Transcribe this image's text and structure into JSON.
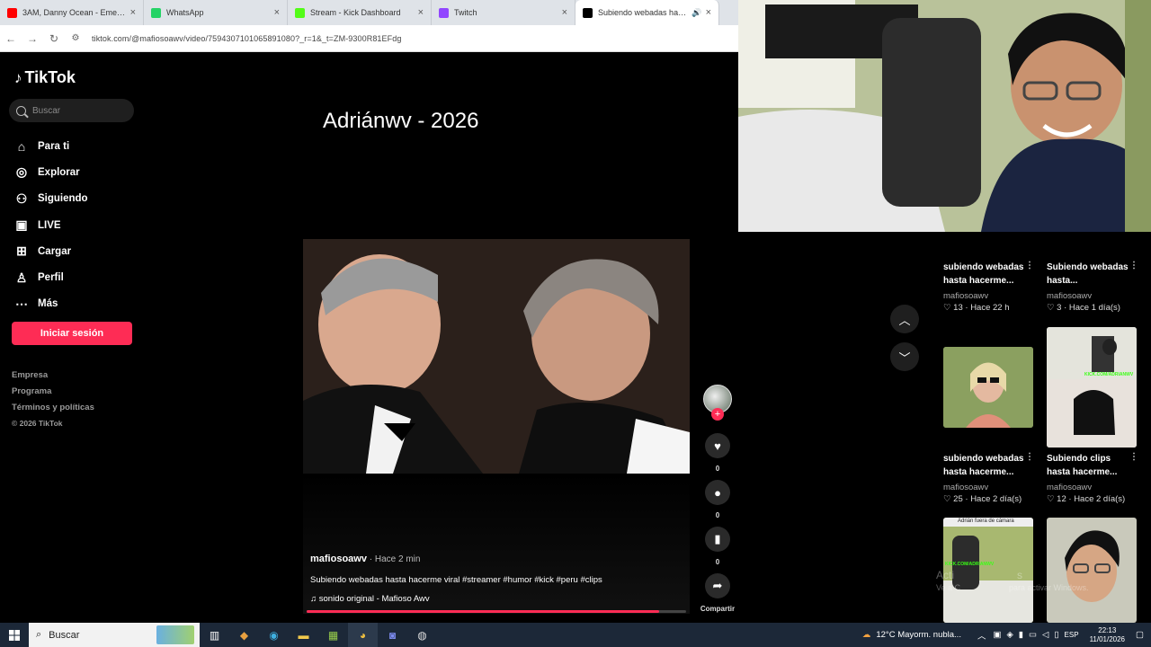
{
  "browser": {
    "tabs": [
      {
        "label": "3AM, Danny Ocean - Emeycé (V",
        "icon": "youtube-icon",
        "color": "#ff0000"
      },
      {
        "label": "WhatsApp",
        "icon": "whatsapp-icon",
        "color": "#25d366"
      },
      {
        "label": "Stream - Kick Dashboard",
        "icon": "kick-icon",
        "color": "#53fc18"
      },
      {
        "label": "Twitch",
        "icon": "twitch-icon",
        "color": "#9146ff"
      },
      {
        "label": "Subiendo webadas hasta h",
        "icon": "tiktok-icon",
        "color": "#000000"
      }
    ],
    "url": "tiktok.com/@mafiosoawv/video/7594307101065891080?_r=1&_t=ZM-9300R81EFdg"
  },
  "sidebar": {
    "logo": "TikTok",
    "search_placeholder": "Buscar",
    "menu": [
      {
        "label": "Para ti",
        "icon": "home-icon",
        "glyph": "⌂"
      },
      {
        "label": "Explorar",
        "icon": "compass-icon",
        "glyph": "◎"
      },
      {
        "label": "Siguiendo",
        "icon": "following-icon",
        "glyph": "⚇"
      },
      {
        "label": "LIVE",
        "icon": "live-icon",
        "glyph": "▣"
      },
      {
        "label": "Cargar",
        "icon": "upload-icon",
        "glyph": "⊞"
      },
      {
        "label": "Perfil",
        "icon": "profile-icon",
        "glyph": "♙"
      },
      {
        "label": "Más",
        "icon": "more-icon",
        "glyph": "⋯"
      }
    ],
    "login": "Iniciar sesión",
    "footer": [
      "Empresa",
      "Programa",
      "Términos y políticas"
    ],
    "copyright": "© 2026 TikTok"
  },
  "video": {
    "title": "Adriánwv - 2026",
    "author": "mafiosoawv",
    "time": " · Hace 2 min",
    "description": "Subiendo webadas hasta hacerme viral #streamer #humor #kick #peru #clips",
    "sound": "sonido original - Mafioso Awv",
    "progress": 0.93
  },
  "actions": {
    "likes": "0",
    "comments": "0",
    "saves": "0",
    "share": "Compartir"
  },
  "recommendations": [
    {
      "title": "subiendo webadas hasta hacerme...",
      "author": "mafiosoawv",
      "likes": "13",
      "age": "Hace 22 h"
    },
    {
      "title": "Subiendo webadas hasta...",
      "author": "mafiosoawv",
      "likes": "3",
      "age": "Hace 1 día(s)"
    },
    {
      "title": "subiendo webadas hasta hacerme...",
      "author": "mafiosoawv",
      "likes": "25",
      "age": "Hace 2 día(s)"
    },
    {
      "title": "Subiendo clips hasta hacerme...",
      "author": "mafiosoawv",
      "likes": "12",
      "age": "Hace 2 día(s)"
    }
  ],
  "thumb_texts": {
    "kick_tag": "KICK.COM/ADRIANWV",
    "away": "Adrián fuera de cámara"
  },
  "watermark": {
    "line1": "Acti",
    "line1b": "s",
    "line2": "Ve a C",
    "line2b": "para activar Windows."
  },
  "taskbar": {
    "search": "Buscar",
    "weather": "12°C  Mayorm. nubla...",
    "lang": "ESP",
    "time": "22:13",
    "date": "11/01/2026"
  }
}
